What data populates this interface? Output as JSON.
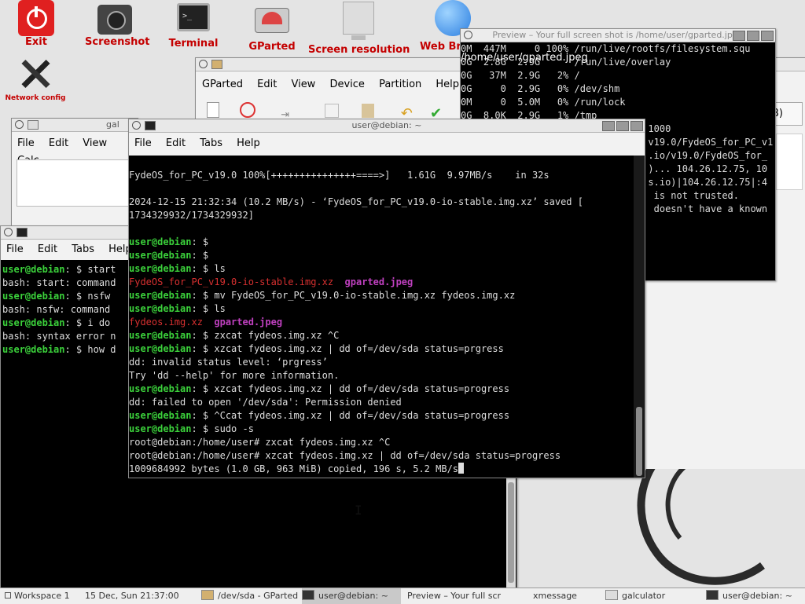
{
  "desktop": {
    "icons": [
      {
        "label": "Exit",
        "icon": "power-icon"
      },
      {
        "label": "Screenshot",
        "icon": "camera-icon"
      },
      {
        "label": "Terminal",
        "icon": "terminal-icon"
      },
      {
        "label": "GParted",
        "icon": "disk-icon"
      },
      {
        "label": "Screen resolution",
        "icon": "monitor-icon"
      },
      {
        "label": "Web Br",
        "icon": "globe-icon"
      },
      {
        "label": "Network config",
        "icon": "tools-icon"
      }
    ]
  },
  "preview": {
    "title": "Preview – Your full screen shot is /home/user/gparted.jpeg",
    "overlay": "/home/user/gparted.jpeg",
    "lines": [
      "0M  447M     0 100% /run/live/rootfs/filesystem.squ",
      "0G  2.8G  2.9G      /run/live/overlay",
      "",
      "0G   37M  2.9G   2% /",
      "0G     0  2.9G   0% /dev/shm",
      "0M     0  5.0M   0% /run/lock",
      "0G  8.0K  2.9G   1% /tmp",
      "",
      "                                 1000",
      "                                 v19.0/FydeOS_for_PC_v1",
      "",
      "                                 .io/v19.0/FydeOS_for_",
      "",
      "                                 )... 104.26.12.75, 10",
      "",
      "                                 s.io)|104.26.12.75|:4",
      "",
      "                                  is not trusted.",
      "                                  doesn't have a known"
    ]
  },
  "gparted": {
    "menu": [
      "GParted",
      "Edit",
      "View",
      "Device",
      "Partition",
      "Help"
    ],
    "partial": "B)"
  },
  "galculator": {
    "title": "gal",
    "menu": [
      "File",
      "Edit",
      "View",
      "Calc"
    ]
  },
  "term_small": {
    "menu": [
      "File",
      "Edit",
      "Tabs",
      "Help"
    ],
    "lines": [
      {
        "p": "user@debian",
        "t": ": $ start"
      },
      {
        "p": "",
        "t": "bash: start: command"
      },
      {
        "p": "user@debian",
        "t": ": $ nsfw"
      },
      {
        "p": "",
        "t": "bash: nsfw: command"
      },
      {
        "p": "user@debian",
        "t": ": $ i do"
      },
      {
        "p": "",
        "t": "bash: syntax error n"
      },
      {
        "p": "user@debian",
        "t": ": $ how d"
      }
    ]
  },
  "term_main": {
    "title": "user@debian: ~",
    "menu": [
      "File",
      "Edit",
      "Tabs",
      "Help"
    ],
    "prompt": "user@debian",
    "lines": {
      "l1": "FydeOS_for_PC_v19.0 100%[+++++++++++++++====>]   1.61G  9.97MB/s    in 32s",
      "l2": "2024-12-15 21:32:34 (10.2 MB/s) - ‘FydeOS_for_PC_v19.0-io-stable.img.xz’ saved [",
      "l3": "1734329932/1734329932]",
      "c1": ": $",
      "c2": ": $",
      "c3": ": $ ls",
      "f1a": "FydeOS_for_PC_v19.0-io-stable.img.xz",
      "f1b": "gparted.jpeg",
      "c4": ": $ mv FydeOS_for_PC_v19.0-io-stable.img.xz fydeos.img.xz",
      "c5": ": $ ls",
      "f2a": "fydeos.img.xz",
      "f2b": "gparted.jpeg",
      "c6": ": $ zxcat fydeos.img.xz ^C",
      "c7": ": $ xzcat fydeos.img.xz | dd of=/dev/sda status=prgress",
      "o1": "dd: invalid status level: ‘prgress’",
      "o2": "Try 'dd --help' for more information.",
      "c8": ": $ xzcat fydeos.img.xz | dd of=/dev/sda status=progress",
      "o3": "dd: failed to open '/dev/sda': Permission denied",
      "c9": ": $ ^Ccat fydeos.img.xz | dd of=/dev/sda status=progress",
      "c10": ": $ sudo -s",
      "r1": "root@debian:/home/user# zxcat fydeos.img.xz ^C",
      "r2": "root@debian:/home/user# xzcat fydeos.img.xz | dd of=/dev/sda status=progress",
      "r3": "1009684992 bytes (1.0 GB, 963 MiB) copied, 196 s, 5.2 MB/s"
    }
  },
  "taskbar": {
    "workspace": "Workspace 1",
    "clock": "15 Dec, Sun 21:37:00",
    "tasks": [
      "/dev/sda - GParted",
      "user@debian: ~",
      "Preview – Your full scr",
      "xmessage",
      "galculator",
      "user@debian: ~"
    ]
  },
  "colors": {
    "icon_label": "#c40000",
    "prompt": "#3bd13b",
    "archive": "#d83030",
    "image": "#c040c0"
  }
}
